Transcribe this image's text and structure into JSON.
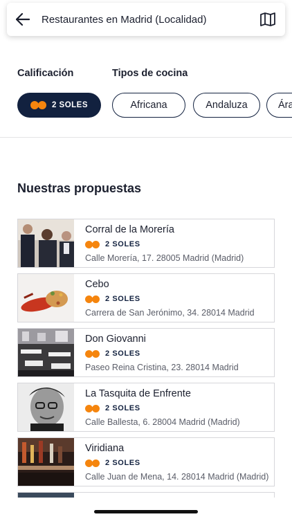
{
  "header": {
    "title": "Restaurantes en Madrid (Localidad)",
    "back_icon": "arrow-left-icon",
    "map_icon": "map-icon"
  },
  "filters": {
    "rating_label": "Calificación",
    "cuisine_label": "Tipos de cocina",
    "rating_chip": "2 SOLES",
    "cuisines": [
      "Africana",
      "Andaluza",
      "Ára"
    ]
  },
  "section_title": "Nuestras propuestas",
  "restaurants": [
    {
      "name": "Corral de la Morería",
      "rating": "2 SOLES",
      "address": "Calle Morería, 17. 28005 Madrid (Madrid)"
    },
    {
      "name": "Cebo",
      "rating": "2 SOLES",
      "address": "Carrera de San Jerónimo, 34. 28014 Madrid"
    },
    {
      "name": "Don Giovanni",
      "rating": "2 SOLES",
      "address": "Paseo Reina Cristina, 23. 28014 Madrid"
    },
    {
      "name": "La Tasquita de Enfrente",
      "rating": "2 SOLES",
      "address": "Calle Ballesta, 6. 28004 Madrid (Madrid)"
    },
    {
      "name": "Viridiana",
      "rating": "2 SOLES",
      "address": "Calle Juan de Mena, 14. 28014 Madrid (Madrid)"
    }
  ],
  "colors": {
    "navy": "#12213f",
    "sun_orange": "#f5850e",
    "border": "#d6d6da"
  }
}
